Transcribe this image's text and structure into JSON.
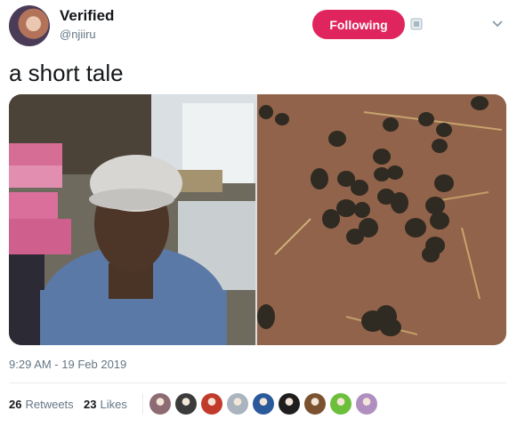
{
  "author": {
    "display_name": "Verified",
    "handle": "@njiiru"
  },
  "actions": {
    "follow_label": "Following"
  },
  "tweet": {
    "text": "a short tale",
    "timestamp": "9:29 AM - 19 Feb 2019"
  },
  "stats": {
    "retweets_count": "26",
    "retweets_label": "Retweets",
    "likes_count": "23",
    "likes_label": "Likes"
  },
  "colors": {
    "follow_button": "#e0245e",
    "secondary_text": "#657786",
    "primary_text": "#14171a"
  },
  "likers": [
    {
      "color": "#8e6a73"
    },
    {
      "color": "#3b3b3b"
    },
    {
      "color": "#c23b2a"
    },
    {
      "color": "#aab4be"
    },
    {
      "color": "#2a5a9a"
    },
    {
      "color": "#1e1e1e"
    },
    {
      "color": "#7a5230"
    },
    {
      "color": "#6cbf3a"
    },
    {
      "color": "#b08fc0"
    }
  ]
}
